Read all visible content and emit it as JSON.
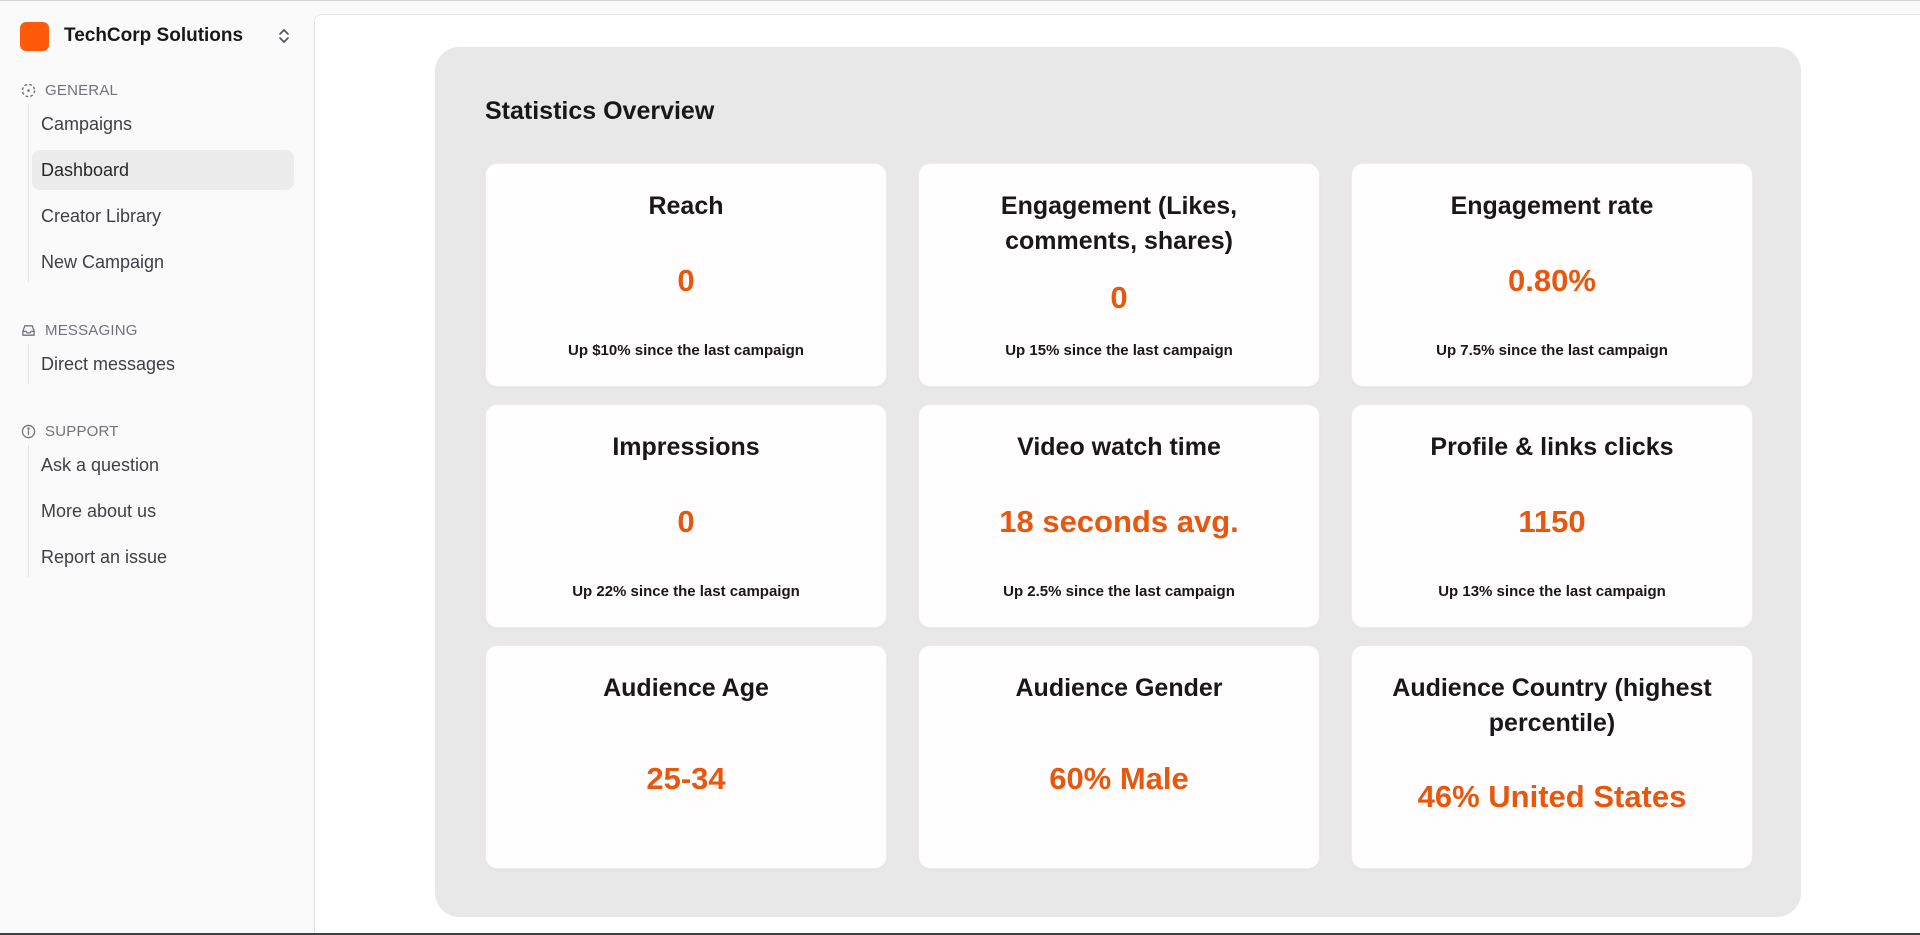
{
  "org": {
    "name": "TechCorp Solutions",
    "logo_color": "#ff5a0a"
  },
  "sidebar": {
    "sections": [
      {
        "title": "GENERAL",
        "icon": "dashed-circle-icon",
        "items": [
          "Campaigns",
          "Dashboard",
          "Creator Library",
          "New Campaign"
        ]
      },
      {
        "title": "MESSAGING",
        "icon": "inbox-icon",
        "items": [
          "Direct messages"
        ]
      },
      {
        "title": "SUPPORT",
        "icon": "info-icon",
        "items": [
          "Ask a question",
          "More about us",
          "Report an issue"
        ]
      }
    ],
    "active_item": "Dashboard"
  },
  "main": {
    "title": "Statistics Overview",
    "accent_color": "#e8570e",
    "cards": [
      {
        "title": "Reach",
        "value": "0",
        "subtitle": "Up $10% since the last campaign"
      },
      {
        "title": "Engagement (Likes, comments, shares)",
        "value": "0",
        "subtitle": "Up 15% since the last campaign"
      },
      {
        "title": "Engagement rate",
        "value": "0.80%",
        "subtitle": "Up 7.5% since the last campaign"
      },
      {
        "title": "Impressions",
        "value": "0",
        "subtitle": "Up 22% since the last campaign"
      },
      {
        "title": "Video watch time",
        "value": "18 seconds avg.",
        "subtitle": "Up 2.5% since the last campaign"
      },
      {
        "title": "Profile & links clicks",
        "value": "1150",
        "subtitle": "Up 13% since the last campaign"
      },
      {
        "title": "Audience Age",
        "value": "25-34",
        "subtitle": ""
      },
      {
        "title": "Audience Gender",
        "value": "60% Male",
        "subtitle": ""
      },
      {
        "title": "Audience Country (highest percentile)",
        "value": "46% United States",
        "subtitle": ""
      }
    ]
  }
}
